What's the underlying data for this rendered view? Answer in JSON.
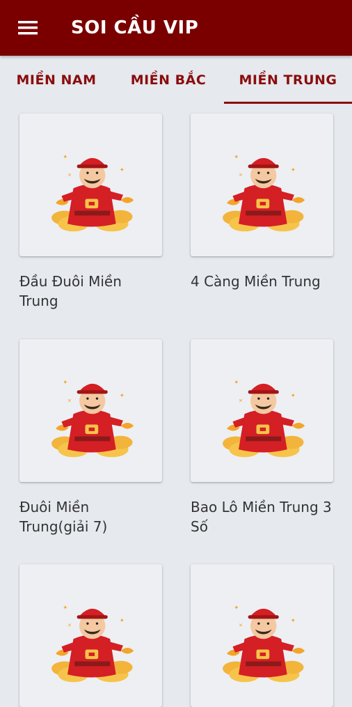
{
  "app": {
    "title": "SOI CẦU VIP"
  },
  "tabs": [
    {
      "label": "MIỀN NAM"
    },
    {
      "label": "MIỀN BẮC"
    },
    {
      "label": "MIỀN TRUNG"
    }
  ],
  "active_tab_index": 2,
  "colors": {
    "appbar": "#7a0000",
    "accent": "#8a0d0d"
  },
  "cards": [
    {
      "title": "Đầu Đuôi Miền Trung",
      "icon": "god-of-wealth-image"
    },
    {
      "title": "4 Càng Miền Trung",
      "icon": "god-of-wealth-image"
    },
    {
      "title": "Đuôi Miền Trung(giải 7)",
      "icon": "god-of-wealth-image"
    },
    {
      "title": "Bao Lô Miền Trung 3 Số",
      "icon": "god-of-wealth-image"
    },
    {
      "title": "",
      "icon": "god-of-wealth-image"
    },
    {
      "title": "",
      "icon": "god-of-wealth-image"
    }
  ]
}
